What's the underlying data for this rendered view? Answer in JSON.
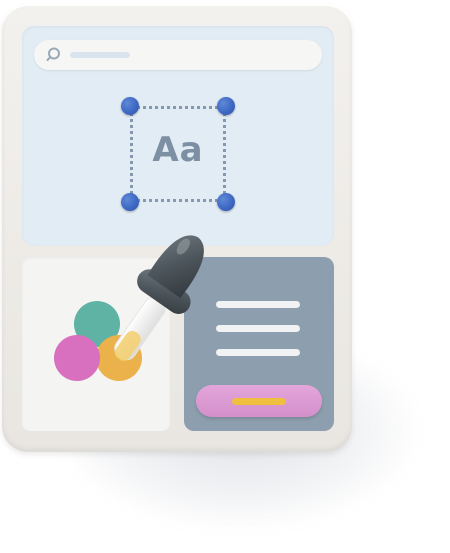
{
  "search": {
    "icon": "search-icon"
  },
  "text_tool": {
    "label": "Aa"
  },
  "palette": {
    "colors": [
      "#5fb3a4",
      "#d86fbf",
      "#ebb24c"
    ]
  },
  "text_panel": {
    "line_count": 3
  },
  "button": {
    "color": "#dc9ad3",
    "bar_color": "#f0bf3f"
  },
  "tool": {
    "icon": "eyedropper-icon"
  }
}
